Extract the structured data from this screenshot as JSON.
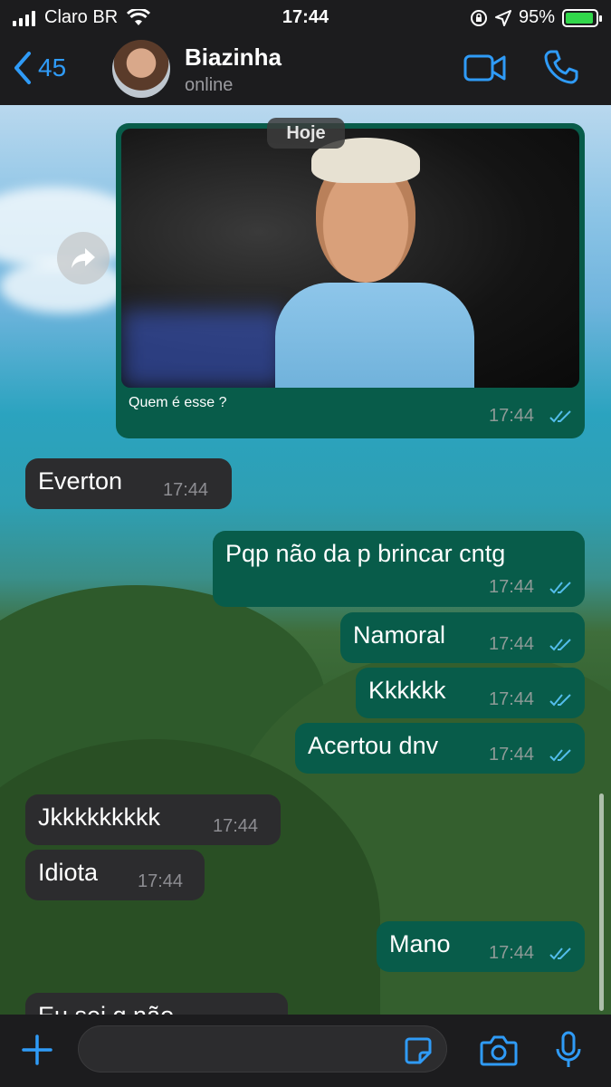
{
  "status_bar": {
    "carrier": "Claro BR",
    "time": "17:44",
    "battery": "95%"
  },
  "header": {
    "back_count": "45",
    "contact_name": "Biazinha",
    "contact_status": "online"
  },
  "chat": {
    "date_label": "Hoje",
    "messages": [
      {
        "direction": "out",
        "type": "image",
        "text": "Quem é esse ?",
        "time": "17:44",
        "status": "read"
      },
      {
        "direction": "in",
        "text": "Everton",
        "time": "17:44"
      },
      {
        "direction": "out",
        "text": "Pqp não da p brincar cntg",
        "time": "17:44",
        "status": "read"
      },
      {
        "direction": "out",
        "text": "Namoral",
        "time": "17:44",
        "status": "read"
      },
      {
        "direction": "out",
        "text": "Kkkkkk",
        "time": "17:44",
        "status": "read"
      },
      {
        "direction": "out",
        "text": "Acertou dnv",
        "time": "17:44",
        "status": "read"
      },
      {
        "direction": "in",
        "text": "Jkkkkkkkkk",
        "time": "17:44"
      },
      {
        "direction": "in",
        "text": "Idiota",
        "time": "17:44"
      },
      {
        "direction": "out",
        "text": "Mano",
        "time": "17:44",
        "status": "read"
      },
      {
        "direction": "in",
        "text": "Eu sei q não",
        "time": ""
      }
    ]
  },
  "input": {
    "value": "",
    "placeholder": ""
  },
  "icons": {
    "back": "chevron-left-icon",
    "video": "video-camera-icon",
    "call": "phone-icon",
    "forward": "forward-icon",
    "add": "plus-icon",
    "sticker": "sticker-icon",
    "camera": "camera-icon",
    "mic": "microphone-icon",
    "read_receipt": "double-check-icon"
  },
  "colors": {
    "accent": "#2f9bf7",
    "outgoing_bubble": "#085c4a",
    "incoming_bubble": "#2c2c2e",
    "battery": "#32d74b",
    "read_check": "#53bdeb"
  }
}
